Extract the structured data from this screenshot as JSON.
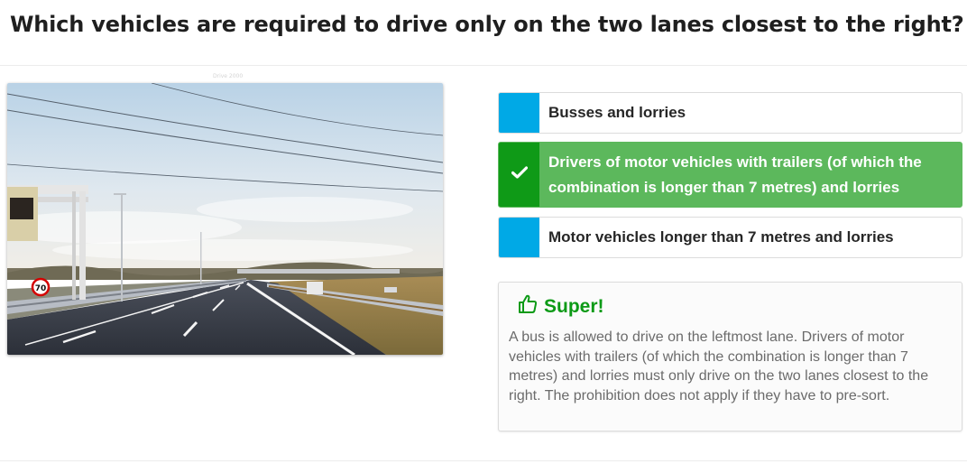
{
  "question": {
    "text": "Which vehicles are required to drive only on the two lanes closest to the right?"
  },
  "image": {
    "watermark": "Drive 2000",
    "sign_speed": "70"
  },
  "answers": [
    {
      "label": "Busses and lorries",
      "state": "neutral"
    },
    {
      "label": "Drivers of motor vehicles with trailers (of which the combination is longer than 7 metres) and lorries",
      "state": "correct",
      "icon": "checkmark-icon"
    },
    {
      "label": "Motor vehicles longer than 7 metres and lorries",
      "state": "neutral"
    }
  ],
  "feedback": {
    "icon": "thumbs-up-icon",
    "title": "Super!",
    "text": "A bus is allowed to drive on the leftmost lane. Drivers of motor vehicles with trailers (of which the combination is longer than 7 metres) and lorries must only drive on the two lanes closest to the right. The prohibition does not apply if they have to pre-sort."
  },
  "colors": {
    "accent_blue": "#00a9e6",
    "correct_green": "#5cb85c",
    "correct_marker_green": "#0f9a17",
    "feedback_title_green": "#0c9a16"
  }
}
